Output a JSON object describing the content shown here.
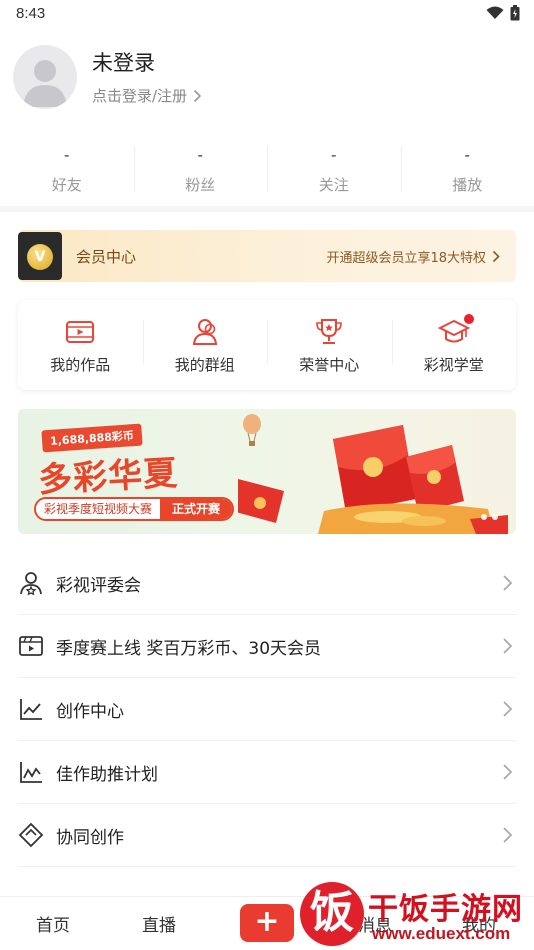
{
  "status_bar": {
    "time": "8:43",
    "icons": [
      "wifi-icon",
      "battery-icon"
    ]
  },
  "profile": {
    "name": "未登录",
    "login_prompt": "点击登录/注册"
  },
  "stats": [
    {
      "value": "-",
      "label": "好友"
    },
    {
      "value": "-",
      "label": "粉丝"
    },
    {
      "value": "-",
      "label": "关注"
    },
    {
      "value": "-",
      "label": "播放"
    }
  ],
  "vip": {
    "badge": "V",
    "title": "会员中心",
    "promo": "开通超级会员立享18大特权"
  },
  "quick_actions": [
    {
      "label": "我的作品",
      "icon": "video-icon"
    },
    {
      "label": "我的群组",
      "icon": "group-icon"
    },
    {
      "label": "荣誉中心",
      "icon": "trophy-icon"
    },
    {
      "label": "彩视学堂",
      "icon": "graduation-cap-icon",
      "badge_dot": true
    }
  ],
  "banner": {
    "amount": "1,688,888彩币",
    "title": "多彩华夏",
    "subtitle": "彩视季度短视频大赛",
    "cta": "正式开赛"
  },
  "menu": [
    {
      "label": "彩视评委会",
      "icon": "judge-icon"
    },
    {
      "label": "季度赛上线 奖百万彩币、30天会员",
      "icon": "clapperboard-icon"
    },
    {
      "label": "创作中心",
      "icon": "line-chart-icon"
    },
    {
      "label": "佳作助推计划",
      "icon": "trend-chart-icon"
    },
    {
      "label": "协同创作",
      "icon": "collab-icon"
    }
  ],
  "bottom_nav": {
    "home": "首页",
    "live": "直播",
    "add": "+",
    "messages": "消息",
    "me": "我的"
  },
  "colors": {
    "accent": "#ea3b30",
    "vip_gold": "#d9a520",
    "vip_text": "#7a4a12"
  },
  "watermark": {
    "logo": "饭",
    "title": "干饭手游网",
    "url": "www.eduext.com"
  }
}
